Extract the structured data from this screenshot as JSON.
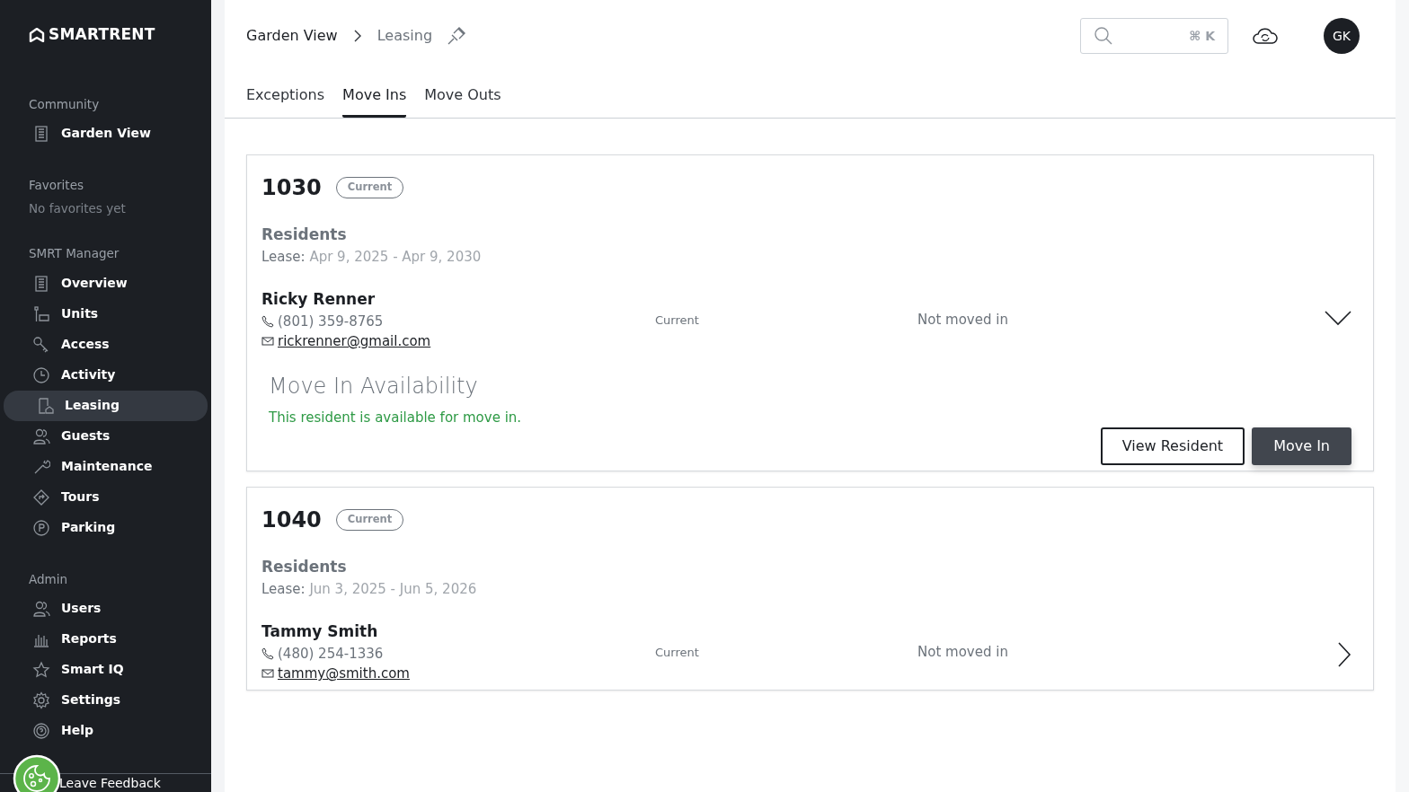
{
  "sidebar": {
    "logo": "SMARTRENT",
    "sections": [
      {
        "heading": "Community",
        "items": [
          {
            "label": "Garden View",
            "selected": false
          }
        ]
      },
      {
        "heading": "Favorites",
        "empty_text": "No favorites yet"
      },
      {
        "heading": "SMRT Manager",
        "items": [
          {
            "label": "Overview",
            "selected": false
          },
          {
            "label": "Units",
            "selected": false
          },
          {
            "label": "Access",
            "selected": false
          },
          {
            "label": "Activity",
            "selected": false
          },
          {
            "label": "Leasing",
            "selected": true
          },
          {
            "label": "Guests",
            "selected": false
          },
          {
            "label": "Maintenance",
            "selected": false
          },
          {
            "label": "Tours",
            "selected": false
          },
          {
            "label": "Parking",
            "selected": false
          }
        ]
      },
      {
        "heading": "Admin",
        "items": [
          {
            "label": "Users",
            "selected": false
          },
          {
            "label": "Reports",
            "selected": false
          },
          {
            "label": "Smart IQ",
            "selected": false
          },
          {
            "label": "Settings",
            "selected": false
          },
          {
            "label": "Help",
            "selected": false
          }
        ]
      }
    ],
    "feedback": "Leave Feedback"
  },
  "header": {
    "breadcrumb": [
      "Garden View",
      "Leasing"
    ],
    "search_shortcut": "⌘ K",
    "avatar": "GK"
  },
  "tabs": [
    {
      "label": "Exceptions",
      "selected": false
    },
    {
      "label": "Move Ins",
      "selected": true
    },
    {
      "label": "Move Outs",
      "selected": false
    }
  ],
  "units": [
    {
      "number": "1030",
      "badge": "Current",
      "section_title": "Residents",
      "lease_label": "Lease:",
      "lease_dates": "Apr 9, 2025 - Apr 9, 2030",
      "residents": [
        {
          "name": "Ricky Renner",
          "phone": "(801) 359-8765",
          "email": "rickrenner@gmail.com",
          "status": "Current",
          "move_status": "Not moved in",
          "expanded": true,
          "availability": {
            "title": "Move In Availability",
            "message": "This resident is available for move in."
          },
          "buttons": [
            {
              "label": "View Resident",
              "kind": "outline"
            },
            {
              "label": "Move In",
              "kind": "primary"
            }
          ]
        }
      ]
    },
    {
      "number": "1040",
      "badge": "Current",
      "section_title": "Residents",
      "lease_label": "Lease:",
      "lease_dates": "Jun 3, 2025 - Jun 5, 2026",
      "residents": [
        {
          "name": "Tammy Smith",
          "phone": "(480) 254-1336",
          "email": "tammy@smith.com",
          "status": "Current",
          "move_status": "Not moved in",
          "expanded": false
        }
      ]
    }
  ]
}
